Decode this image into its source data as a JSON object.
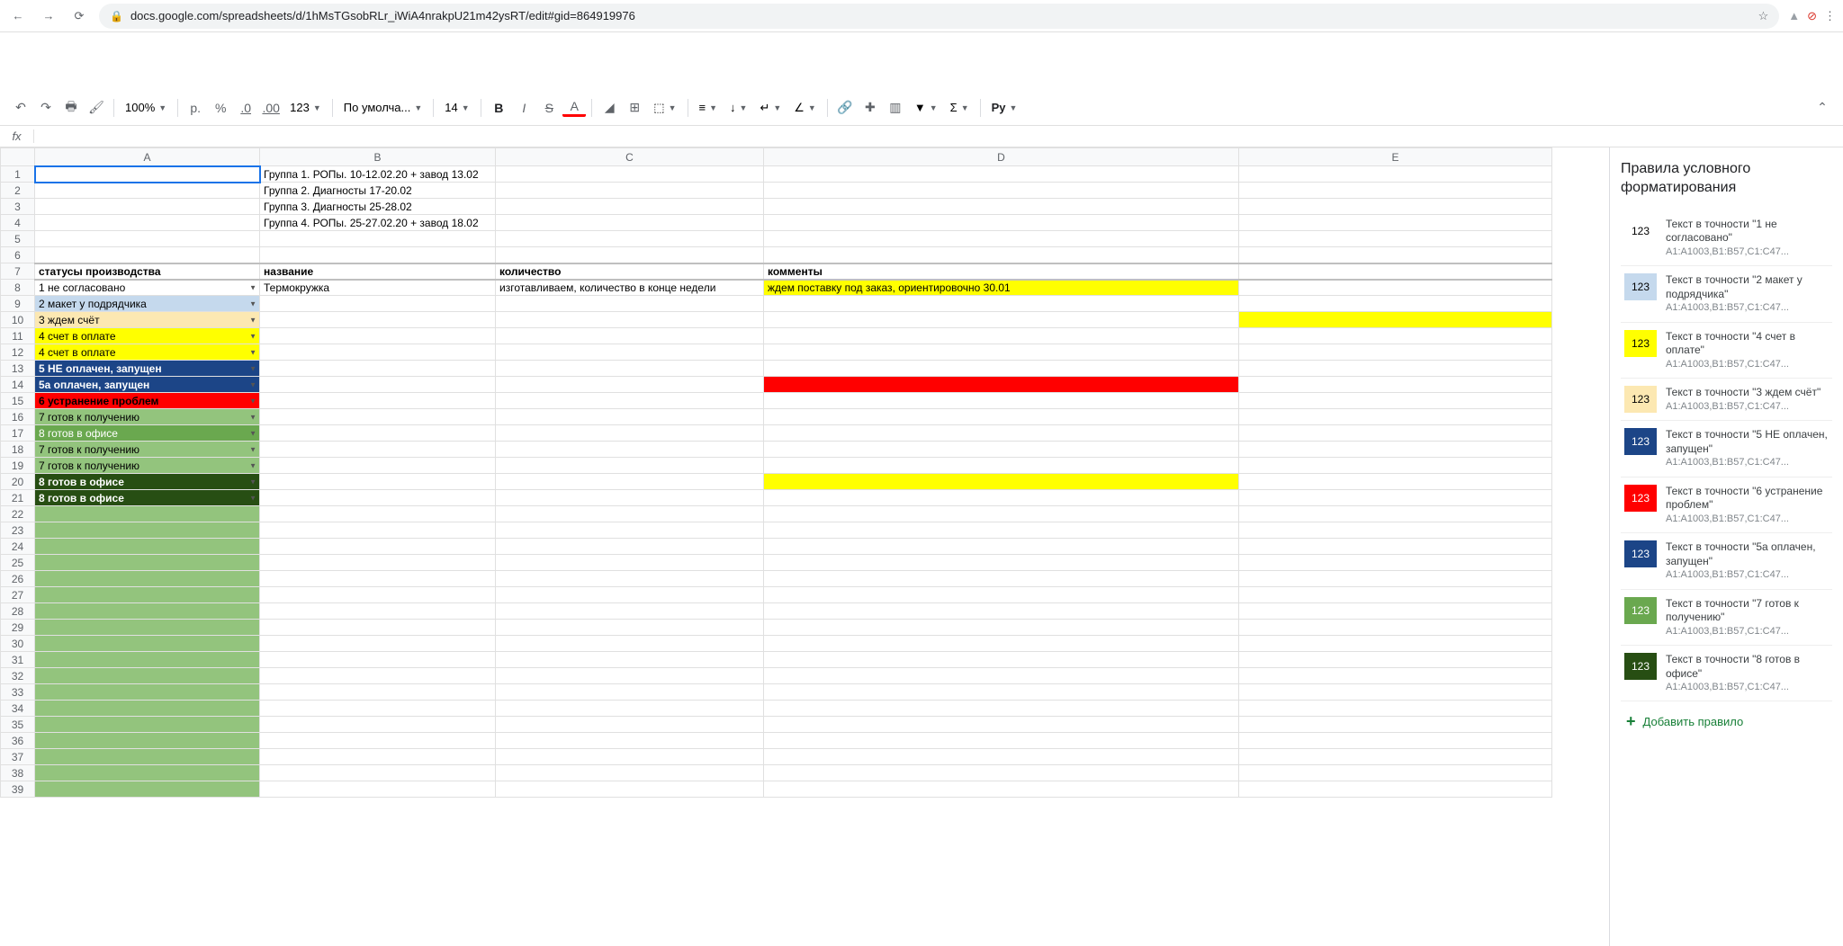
{
  "browser": {
    "url": "docs.google.com/spreadsheets/d/1hMsTGsobRLr_iWiA4nrakpU21m42ysRT/edit#gid=864919976"
  },
  "toolbar": {
    "zoom": "100%",
    "currency": "р.",
    "percent": "%",
    "dec_less": ".0",
    "dec_more": ".00",
    "fmt123": "123",
    "font": "По умолча...",
    "fontsize": "14",
    "more": "Py"
  },
  "columns": [
    "A",
    "B",
    "C",
    "D",
    "E"
  ],
  "cells": {
    "b1": "Группа 1. РОПы. 10-12.02.20 + завод 13.02",
    "b2": "Группа 2. Диагносты 17-20.02",
    "b3": "Группа 3. Диагносты 25-28.02",
    "b4": "Группа 4. РОПы. 25-27.02.20 + завод 18.02",
    "a7": "статусы производства",
    "b7": "название",
    "c7": "количество",
    "d7": "комменты",
    "a8": "1 не согласовано",
    "b8": "Термокружка",
    "c8": "изготавливаем, количество в конце недели",
    "d8": "ждем поставку под заказ, ориентировочно 30.01",
    "a9": "2 макет у подрядчика",
    "a10": "3 ждем счёт",
    "a11": "4 счет в оплате",
    "a12": "4 счет в оплате",
    "a13": "5 НЕ оплачен, запущен",
    "a14": "5а оплачен, запущен",
    "a15": "6 устранение проблем",
    "a16": "7 готов к получению",
    "a17": "8 готов в офисе",
    "a18": "7 готов к получению",
    "a19": "7 готов к получению",
    "a20": "8 готов в офисе",
    "a21": "8 готов в офисе"
  },
  "panel": {
    "title": "Правила условного форматирования",
    "range": "A1:A1003,B1:B57,C1:C47...",
    "rules": [
      {
        "swatch_bg": "#ffffff",
        "swatch_color": "#000",
        "text": "Текст в точности \"1 не согласовано\""
      },
      {
        "swatch_bg": "#c5d9ed",
        "swatch_color": "#000",
        "text": "Текст в точности \"2 макет у подрядчика\""
      },
      {
        "swatch_bg": "#ffff00",
        "swatch_color": "#000",
        "text": "Текст в точности \"4 счет в оплате\""
      },
      {
        "swatch_bg": "#fce8b2",
        "swatch_color": "#000",
        "text": "Текст в точности \"3 ждем счёт\""
      },
      {
        "swatch_bg": "#1c4587",
        "swatch_color": "#fff",
        "text": "Текст в точности \"5 НЕ оплачен, запущен\""
      },
      {
        "swatch_bg": "#ff0000",
        "swatch_color": "#fff",
        "text": "Текст в точности \"6 устранение проблем\""
      },
      {
        "swatch_bg": "#1c4587",
        "swatch_color": "#fff",
        "text": "Текст в точности \"5а оплачен, запущен\""
      },
      {
        "swatch_bg": "#6aa84f",
        "swatch_color": "#fff",
        "text": "Текст в точности \"7 готов к получению\""
      },
      {
        "swatch_bg": "#274e13",
        "swatch_color": "#fff",
        "text": "Текст в точности \"8 готов в офисе\""
      }
    ],
    "sample": "123",
    "add": "Добавить правило"
  }
}
